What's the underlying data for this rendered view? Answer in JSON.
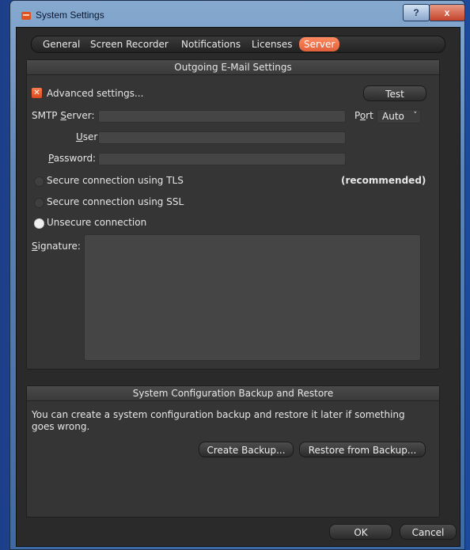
{
  "window": {
    "title": "System Settings",
    "help_label": "?",
    "close_label": "x"
  },
  "tabs": [
    {
      "label": "General"
    },
    {
      "label": "Screen Recorder"
    },
    {
      "label": "Notifications"
    },
    {
      "label": "Licenses"
    },
    {
      "label": "Server",
      "active": true
    }
  ],
  "email": {
    "section_title": "Outgoing E-Mail Settings",
    "advanced_label": "Advanced settings...",
    "test_label": "Test",
    "smtp_prefix": "SMTP ",
    "smtp_accel": "S",
    "smtp_rest": "erver:",
    "smtp_value": "",
    "port_prefix": "P",
    "port_accel": "o",
    "port_rest": "rt",
    "port_value": "Auto",
    "user_accel": "U",
    "user_rest": "ser:",
    "user_value": "",
    "password_accel": "P",
    "password_rest": "assword:",
    "password_value": "",
    "tls_label": "Secure connection using TLS",
    "recommended_label": "(recommended)",
    "ssl_label": "Secure connection using SSL",
    "unsecure_label": "Unsecure connection",
    "signature_accel": "S",
    "signature_rest": "ignature:",
    "signature_value": ""
  },
  "backup": {
    "section_title": "System Configuration Backup and Restore",
    "description": "You can create a system configuration backup and restore it later if something goes wrong.",
    "create_label": "Create Backup...",
    "restore_label": "Restore from Backup..."
  },
  "footer": {
    "ok_label": "OK",
    "cancel_label": "Cancel"
  },
  "colors": {
    "accent": "#e8653c",
    "background": "#2a2a2a"
  }
}
